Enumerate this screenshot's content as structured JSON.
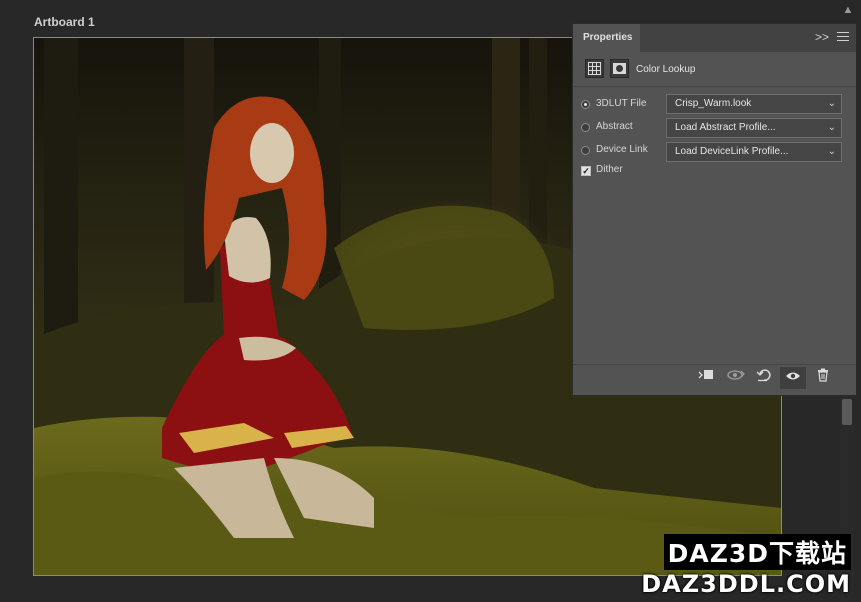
{
  "artboard": {
    "title": "Artboard 1"
  },
  "panel": {
    "tab_label": "Properties",
    "collapse_label": ">>",
    "adjustment_title": "Color Lookup",
    "options": [
      {
        "label": "3DLUT File",
        "value": "Crisp_Warm.look",
        "selected": true
      },
      {
        "label": "Abstract",
        "value": "Load Abstract Profile...",
        "selected": false
      },
      {
        "label": "Device Link",
        "value": "Load DeviceLink Profile...",
        "selected": false
      }
    ],
    "dither": {
      "label": "Dither",
      "checked": true
    },
    "footer_tools": [
      "clip-to-layer-icon",
      "view-previous-state-icon",
      "reset-icon",
      "visibility-eye-icon",
      "trash-icon"
    ]
  },
  "watermark": {
    "line1": "DAZ3D下载站",
    "line2": "DAZ3DDL.COM"
  },
  "colors": {
    "panel_bg": "#535353",
    "canvas_bg": "#282828",
    "dress": "#8c0f12",
    "hair": "#a83a14"
  }
}
